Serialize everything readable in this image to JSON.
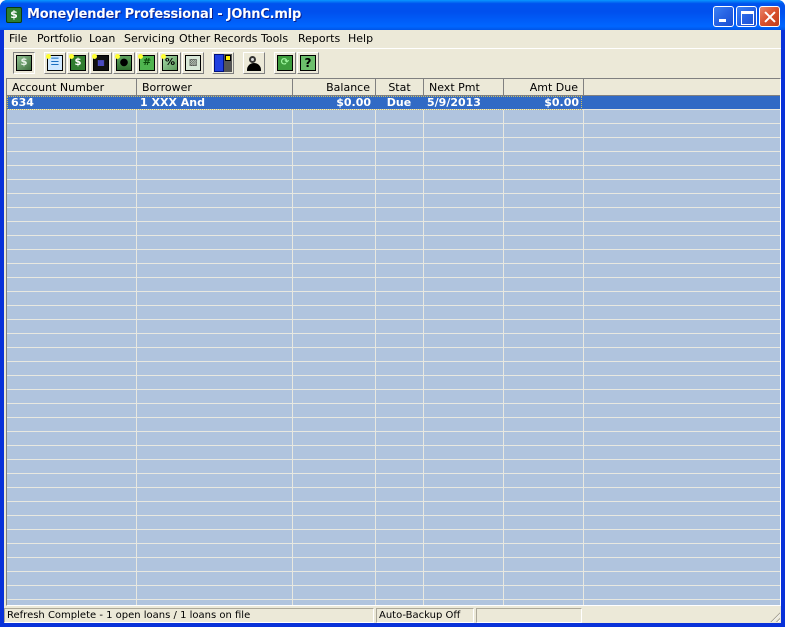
{
  "window": {
    "title": "Moneylender Professional - JOhnC.mlp",
    "app_icon": "dollar-icon",
    "controls": [
      "minimize",
      "maximize",
      "close"
    ]
  },
  "menubar": {
    "items": [
      {
        "label": "File"
      },
      {
        "label": "Portfolio"
      },
      {
        "label": "Loan"
      },
      {
        "label": "Servicing"
      },
      {
        "label": "Other Records"
      },
      {
        "label": "Tools"
      },
      {
        "label": "Reports"
      },
      {
        "label": "Help"
      }
    ]
  },
  "toolbar": {
    "buttons": [
      {
        "icon": "money-icon",
        "glyph": "$",
        "pressed": true
      },
      {
        "icon": "ledger-icon",
        "glyph": "☰"
      },
      {
        "icon": "loan-dollar-icon",
        "glyph": "$"
      },
      {
        "icon": "factory-icon",
        "glyph": "▦"
      },
      {
        "icon": "person-icon",
        "glyph": "●"
      },
      {
        "icon": "hash-dollar-icon",
        "glyph": "#"
      },
      {
        "icon": "percent-icon",
        "glyph": "%"
      },
      {
        "icon": "document-icon",
        "glyph": "▨"
      },
      {
        "icon": "calculator-icon"
      },
      {
        "icon": "search-person-icon"
      },
      {
        "icon": "refresh-icon",
        "glyph": "⟳"
      },
      {
        "icon": "help-icon",
        "glyph": "?"
      }
    ]
  },
  "grid": {
    "columns": [
      {
        "label": "Account Number",
        "align": "left"
      },
      {
        "label": "Borrower",
        "align": "left"
      },
      {
        "label": "Balance",
        "align": "right"
      },
      {
        "label": "Stat",
        "align": "center"
      },
      {
        "label": "Next Pmt",
        "align": "left"
      },
      {
        "label": "Amt Due",
        "align": "right"
      }
    ],
    "rows": [
      {
        "account_number": "634",
        "borrower": "1 XXX And",
        "balance": "$0.00",
        "stat": "Due",
        "next_pmt": "5/9/2013",
        "amt_due": "$0.00",
        "selected": true
      }
    ],
    "colors": {
      "background": "#b0c4de",
      "selection": "#316ac5",
      "gridline": "#e8e8e0"
    }
  },
  "statusbar": {
    "message": "Refresh Complete - 1 open loans / 1 loans on file",
    "backup_status": "Auto-Backup Off",
    "extra": ""
  }
}
